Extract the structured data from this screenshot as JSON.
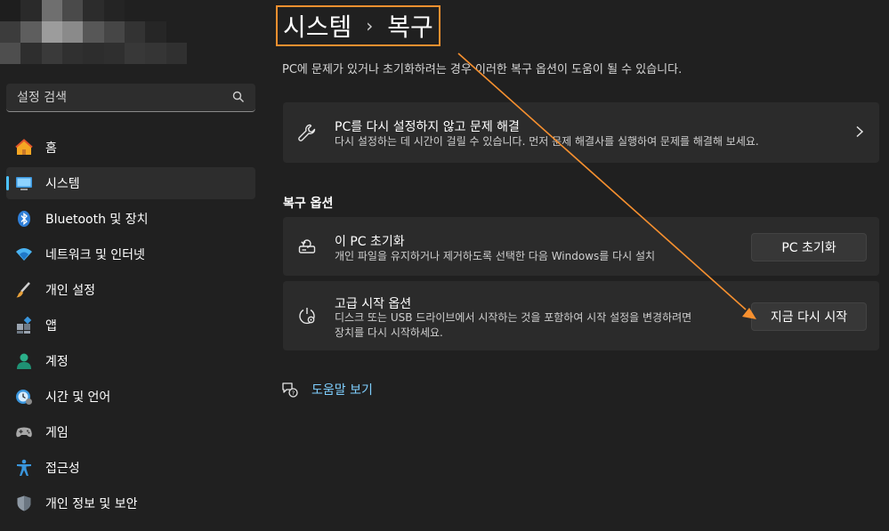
{
  "sidebar": {
    "search": {
      "placeholder": "설정 검색",
      "icon": "search-icon"
    },
    "items": [
      {
        "label": "홈",
        "icon": "home-icon"
      },
      {
        "label": "시스템",
        "icon": "system-icon",
        "active": true
      },
      {
        "label": "Bluetooth 및 장치",
        "icon": "bluetooth-icon"
      },
      {
        "label": "네트워크 및 인터넷",
        "icon": "wifi-icon"
      },
      {
        "label": "개인 설정",
        "icon": "brush-icon"
      },
      {
        "label": "앱",
        "icon": "apps-icon"
      },
      {
        "label": "계정",
        "icon": "account-icon"
      },
      {
        "label": "시간 및 언어",
        "icon": "clock-globe-icon"
      },
      {
        "label": "게임",
        "icon": "gamepad-icon"
      },
      {
        "label": "접근성",
        "icon": "accessibility-icon"
      },
      {
        "label": "개인 정보 및 보안",
        "icon": "shield-icon"
      }
    ]
  },
  "header": {
    "breadcrumb_parent": "시스템",
    "breadcrumb_sep": "›",
    "breadcrumb_current": "복구"
  },
  "main": {
    "description": "PC에 문제가 있거나 초기화하려는 경우 이러한 복구 옵션이 도움이 될 수 있습니다.",
    "troubleshoot": {
      "title": "PC를 다시 설정하지 않고 문제 해결",
      "subtitle": "다시 설정하는 데 시간이 걸릴 수 있습니다. 먼저 문제 해결사를 실행하여 문제를 해결해 보세요.",
      "icon": "wrench-icon"
    },
    "section_title": "복구 옵션",
    "reset_pc": {
      "title": "이 PC 초기화",
      "subtitle": "개인 파일을 유지하거나 제거하도록 선택한 다음 Windows를 다시 설치",
      "button": "PC 초기화",
      "icon": "reset-pc-icon"
    },
    "advanced_startup": {
      "title": "고급 시작 옵션",
      "subtitle_line1": "디스크 또는 USB 드라이브에서 시작하는 것을 포함하여 시작 설정을 변경하려면",
      "subtitle_line2": "장치를 다시 시작하세요.",
      "button": "지금 다시 시작",
      "icon": "advanced-startup-icon"
    },
    "help_link": {
      "label": "도움말 보기",
      "icon": "help-icon"
    }
  },
  "colors": {
    "background": "#202020",
    "card": "#2b2b2b",
    "accent": "#4cc2ff",
    "annotation": "#f7902f",
    "link": "#7fcfff"
  }
}
